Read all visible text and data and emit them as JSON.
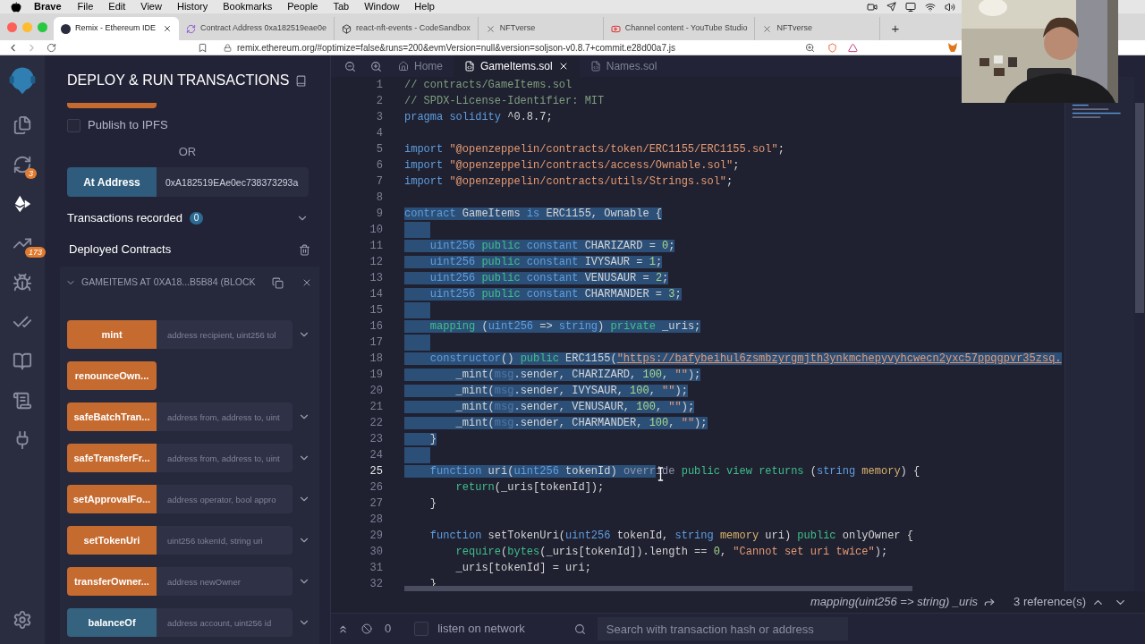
{
  "menu_bar": {
    "app": "Brave",
    "items": [
      "File",
      "Edit",
      "View",
      "History",
      "Bookmarks",
      "People",
      "Tab",
      "Window",
      "Help"
    ]
  },
  "browser": {
    "tabs": [
      {
        "title": "Remix - Ethereum IDE",
        "selected": true
      },
      {
        "title": "Contract Address 0xa182519eae0e",
        "selected": false
      },
      {
        "title": "react-nft-events - CodeSandbox",
        "selected": false
      },
      {
        "title": "NFTverse",
        "selected": false
      },
      {
        "title": "Channel content - YouTube Studio",
        "selected": false
      },
      {
        "title": "NFTverse",
        "selected": false
      }
    ],
    "new_tab": "+",
    "url": "remix.ethereum.org/#optimize=false&runs=200&evmVersion=null&version=soljson-v0.8.7+commit.e28d00a7.js"
  },
  "icon_panel": {
    "items": [
      {
        "selected": false
      },
      {
        "selected": false,
        "badge": "3"
      },
      {
        "selected": true
      },
      {
        "selected": false,
        "badge": "173"
      },
      {
        "selected": false
      },
      {
        "selected": false
      },
      {
        "selected": false
      },
      {
        "selected": false
      },
      {
        "selected": false
      },
      {
        "selected": false
      }
    ]
  },
  "side_panel": {
    "title": "DEPLOY & RUN TRANSACTIONS",
    "publish": {
      "label": "Publish to IPFS",
      "checked": false
    },
    "or": "OR",
    "at_address": {
      "button": "At Address",
      "value": "0xA182519EAe0ec738373293a"
    },
    "transactions": {
      "label": "Transactions recorded",
      "count": "0"
    },
    "deployed": {
      "label": "Deployed Contracts"
    },
    "contract": {
      "title": "GAMEITEMS AT 0XA18...B5B84 (BLOCK",
      "expanded": true,
      "functions": [
        {
          "name": "mint",
          "kind": "transact",
          "placeholder": "address recipient, uint256 tol"
        },
        {
          "name": "renounceOwn...",
          "kind": "transact"
        },
        {
          "name": "safeBatchTran...",
          "kind": "transact",
          "placeholder": "address from, address to, uint"
        },
        {
          "name": "safeTransferFr...",
          "kind": "transact",
          "placeholder": "address from, address to, uint"
        },
        {
          "name": "setApprovalFo...",
          "kind": "transact",
          "placeholder": "address operator, bool appro"
        },
        {
          "name": "setTokenUri",
          "kind": "transact",
          "placeholder": "uint256 tokenId, string uri"
        },
        {
          "name": "transferOwner...",
          "kind": "transact",
          "placeholder": "address newOwner"
        },
        {
          "name": "balanceOf",
          "kind": "call",
          "placeholder": "address account, uint256 id"
        }
      ]
    }
  },
  "editor": {
    "tabs": [
      {
        "label": "Home",
        "selected": false
      },
      {
        "label": "GameItems.sol",
        "selected": true
      },
      {
        "label": "Names.sol",
        "selected": false
      }
    ],
    "lines": [
      {
        "number": "1",
        "selected": false,
        "current": false,
        "tokens": [
          {
            "text": "// contracts/GameItems.sol",
            "kind": "comment"
          }
        ]
      },
      {
        "number": "2",
        "selected": false,
        "current": false,
        "tokens": [
          {
            "text": "// SPDX-License-Identifier: MIT",
            "kind": "comment"
          }
        ]
      },
      {
        "number": "3",
        "selected": false,
        "current": false,
        "tokens": [
          {
            "text": "pragma solidity",
            "kind": "keyword"
          },
          {
            "text": " ^0.8.7;",
            "kind": "plain"
          }
        ]
      },
      {
        "number": "4",
        "selected": false,
        "current": false
      },
      {
        "number": "5",
        "selected": false,
        "current": false,
        "tokens": [
          {
            "text": "import",
            "kind": "keyword"
          },
          {
            "text": " \"@openzeppelin/contracts/token/ERC1155/ERC1155.sol\"",
            "kind": "string"
          },
          {
            "text": ";",
            "kind": "plain"
          }
        ]
      },
      {
        "number": "6",
        "selected": false,
        "current": false,
        "tokens": [
          {
            "text": "import",
            "kind": "keyword"
          },
          {
            "text": " \"@openzeppelin/contracts/access/Ownable.sol\"",
            "kind": "string"
          },
          {
            "text": ";",
            "kind": "plain"
          }
        ]
      },
      {
        "number": "7",
        "selected": false,
        "current": false,
        "tokens": [
          {
            "text": "import",
            "kind": "keyword"
          },
          {
            "text": " \"@openzeppelin/contracts/utils/Strings.sol\"",
            "kind": "string"
          },
          {
            "text": ";",
            "kind": "plain"
          }
        ]
      },
      {
        "number": "8",
        "selected": false,
        "current": false
      },
      {
        "number": "9",
        "selected": true,
        "current": false,
        "tokens": [
          {
            "text": "contract",
            "kind": "keyword"
          },
          {
            "text": " GameItems ",
            "kind": "plain"
          },
          {
            "text": "is",
            "kind": "keyword"
          },
          {
            "text": " ERC1155, Ownable {",
            "kind": "plain"
          }
        ]
      },
      {
        "number": "10",
        "selected": true,
        "current": false
      },
      {
        "number": "11",
        "selected": true,
        "current": false,
        "tokens": [
          {
            "text": "    uint256",
            "kind": "keyword"
          },
          {
            "text": " public",
            "kind": "modifier"
          },
          {
            "text": " constant",
            "kind": "keyword"
          },
          {
            "text": " CHARIZARD = ",
            "kind": "plain"
          },
          {
            "text": "0",
            "kind": "number"
          },
          {
            "text": ";",
            "kind": "plain"
          }
        ]
      },
      {
        "number": "12",
        "selected": true,
        "current": false,
        "tokens": [
          {
            "text": "    uint256",
            "kind": "keyword"
          },
          {
            "text": " public",
            "kind": "modifier"
          },
          {
            "text": " constant",
            "kind": "keyword"
          },
          {
            "text": " IVYSAUR = ",
            "kind": "plain"
          },
          {
            "text": "1",
            "kind": "number"
          },
          {
            "text": ";",
            "kind": "plain"
          }
        ]
      },
      {
        "number": "13",
        "selected": true,
        "current": false,
        "tokens": [
          {
            "text": "    uint256",
            "kind": "keyword"
          },
          {
            "text": " public",
            "kind": "modifier"
          },
          {
            "text": " constant",
            "kind": "keyword"
          },
          {
            "text": " VENUSAUR = ",
            "kind": "plain"
          },
          {
            "text": "2",
            "kind": "number"
          },
          {
            "text": ";",
            "kind": "plain"
          }
        ]
      },
      {
        "number": "14",
        "selected": true,
        "current": false,
        "tokens": [
          {
            "text": "    uint256",
            "kind": "keyword"
          },
          {
            "text": " public",
            "kind": "modifier"
          },
          {
            "text": " constant",
            "kind": "keyword"
          },
          {
            "text": " CHARMANDER = ",
            "kind": "plain"
          },
          {
            "text": "3",
            "kind": "number"
          },
          {
            "text": ";",
            "kind": "plain"
          }
        ]
      },
      {
        "number": "15",
        "selected": true,
        "current": false
      },
      {
        "number": "16",
        "selected": true,
        "current": false,
        "tokens": [
          {
            "text": "    mapping",
            "kind": "modifier"
          },
          {
            "text": " (",
            "kind": "plain"
          },
          {
            "text": "uint256",
            "kind": "keyword"
          },
          {
            "text": " => ",
            "kind": "plain"
          },
          {
            "text": "string",
            "kind": "keyword"
          },
          {
            "text": ") ",
            "kind": "plain"
          },
          {
            "text": "private",
            "kind": "modifier"
          },
          {
            "text": " _uris;",
            "kind": "plain"
          }
        ]
      },
      {
        "number": "17",
        "selected": true,
        "current": false
      },
      {
        "number": "18",
        "selected": true,
        "current": false,
        "tokens": [
          {
            "text": "    constructor",
            "kind": "keyword"
          },
          {
            "text": "() ",
            "kind": "plain"
          },
          {
            "text": "public",
            "kind": "modifier"
          },
          {
            "text": " ERC1155(",
            "kind": "plain"
          },
          {
            "text": "\"https://bafybeihul6zsmbzyrgmjth3ynkmchepyvyhcwecn2yxc57ppqgpvr35zsq.",
            "kind": "link"
          }
        ]
      },
      {
        "number": "19",
        "selected": true,
        "current": false,
        "tokens": [
          {
            "text": "        _mint(",
            "kind": "plain"
          },
          {
            "text": "msg",
            "kind": "builtin"
          },
          {
            "text": ".sender, CHARIZARD, ",
            "kind": "plain"
          },
          {
            "text": "100",
            "kind": "number"
          },
          {
            "text": ", ",
            "kind": "plain"
          },
          {
            "text": "\"\"",
            "kind": "string"
          },
          {
            "text": ");",
            "kind": "plain"
          }
        ]
      },
      {
        "number": "20",
        "selected": true,
        "current": false,
        "tokens": [
          {
            "text": "        _mint(",
            "kind": "plain"
          },
          {
            "text": "msg",
            "kind": "builtin"
          },
          {
            "text": ".sender, IVYSAUR, ",
            "kind": "plain"
          },
          {
            "text": "100",
            "kind": "number"
          },
          {
            "text": ", ",
            "kind": "plain"
          },
          {
            "text": "\"\"",
            "kind": "string"
          },
          {
            "text": ");",
            "kind": "plain"
          }
        ]
      },
      {
        "number": "21",
        "selected": true,
        "current": false,
        "tokens": [
          {
            "text": "        _mint(",
            "kind": "plain"
          },
          {
            "text": "msg",
            "kind": "builtin"
          },
          {
            "text": ".sender, VENUSAUR, ",
            "kind": "plain"
          },
          {
            "text": "100",
            "kind": "number"
          },
          {
            "text": ", ",
            "kind": "plain"
          },
          {
            "text": "\"\"",
            "kind": "string"
          },
          {
            "text": ");",
            "kind": "plain"
          }
        ]
      },
      {
        "number": "22",
        "selected": true,
        "current": false,
        "tokens": [
          {
            "text": "        _mint(",
            "kind": "plain"
          },
          {
            "text": "msg",
            "kind": "builtin"
          },
          {
            "text": ".sender, CHARMANDER, ",
            "kind": "plain"
          },
          {
            "text": "100",
            "kind": "number"
          },
          {
            "text": ", ",
            "kind": "plain"
          },
          {
            "text": "\"\"",
            "kind": "string"
          },
          {
            "text": ");",
            "kind": "plain"
          }
        ]
      },
      {
        "number": "23",
        "selected": true,
        "current": false,
        "tokens": [
          {
            "text": "    }",
            "kind": "plain"
          }
        ]
      },
      {
        "number": "24",
        "selected": true,
        "current": false
      },
      {
        "number": "25",
        "selected": true,
        "current": true,
        "tokens": [
          {
            "text": "    function",
            "kind": "keyword"
          },
          {
            "text": " uri(",
            "kind": "plain"
          },
          {
            "text": "uint256",
            "kind": "keyword"
          },
          {
            "text": " tokenId) ",
            "kind": "plain"
          },
          {
            "text": "overr",
            "kind": "faded"
          }
        ],
        "unselected_tail": [
          {
            "text": "ide",
            "kind": "faded"
          },
          {
            "text": " public",
            "kind": "modifier"
          },
          {
            "text": " view",
            "kind": "modifier"
          },
          {
            "text": " returns",
            "kind": "modifier"
          },
          {
            "text": " (",
            "kind": "plain"
          },
          {
            "text": "string",
            "kind": "keyword"
          },
          {
            "text": " memory",
            "kind": "storage"
          },
          {
            "text": ") {",
            "kind": "plain"
          }
        ]
      },
      {
        "number": "26",
        "selected": false,
        "current": false,
        "tokens": [
          {
            "text": "        return",
            "kind": "modifier"
          },
          {
            "text": "(_uris[tokenId]);",
            "kind": "plain"
          }
        ]
      },
      {
        "number": "27",
        "selected": false,
        "current": false,
        "tokens": [
          {
            "text": "    }",
            "kind": "plain"
          }
        ]
      },
      {
        "number": "28",
        "selected": false,
        "current": false
      },
      {
        "number": "29",
        "selected": false,
        "current": false,
        "tokens": [
          {
            "text": "    function",
            "kind": "keyword"
          },
          {
            "text": " setTokenUri(",
            "kind": "plain"
          },
          {
            "text": "uint256",
            "kind": "keyword"
          },
          {
            "text": " tokenId, ",
            "kind": "plain"
          },
          {
            "text": "string",
            "kind": "keyword"
          },
          {
            "text": " memory",
            "kind": "storage"
          },
          {
            "text": " uri) ",
            "kind": "plain"
          },
          {
            "text": "public",
            "kind": "modifier"
          },
          {
            "text": " onlyOwner {",
            "kind": "plain"
          }
        ]
      },
      {
        "number": "30",
        "selected": false,
        "current": false,
        "tokens": [
          {
            "text": "        require",
            "kind": "modifier"
          },
          {
            "text": "(",
            "kind": "plain"
          },
          {
            "text": "bytes",
            "kind": "modifier"
          },
          {
            "text": "(_uris[tokenId]).length == ",
            "kind": "plain"
          },
          {
            "text": "0",
            "kind": "number"
          },
          {
            "text": ", ",
            "kind": "plain"
          },
          {
            "text": "\"Cannot set uri twice\"",
            "kind": "string"
          },
          {
            "text": ");",
            "kind": "plain"
          }
        ]
      },
      {
        "number": "31",
        "selected": false,
        "current": false,
        "tokens": [
          {
            "text": "        _uris[tokenId] = uri;",
            "kind": "plain"
          }
        ]
      },
      {
        "number": "32",
        "selected": false,
        "current": false,
        "tokens": [
          {
            "text": "    }",
            "kind": "plain"
          }
        ]
      }
    ],
    "hover_info": {
      "signature": "mapping(uint256 => string) _uris",
      "references": "3 reference(s)"
    }
  },
  "terminal": {
    "count": "0",
    "listen": {
      "label": "listen on network",
      "checked": false
    },
    "search_placeholder": "Search with transaction hash or address"
  }
}
